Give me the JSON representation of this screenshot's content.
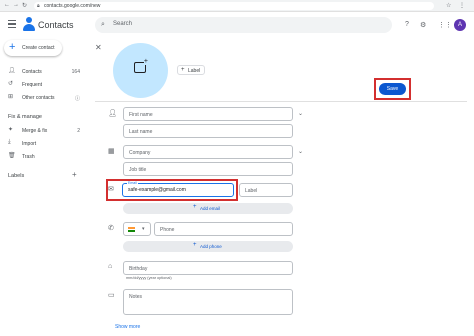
{
  "browser": {
    "url": "contacts.google.com/new",
    "nav_icons": [
      "back-icon",
      "forward-icon",
      "reload-icon"
    ]
  },
  "header": {
    "app_title": "Contacts",
    "search_placeholder": "Search",
    "avatar_letter": "A"
  },
  "sidebar": {
    "create_label": "Create contact",
    "items": [
      {
        "label": "Contacts",
        "count": "164",
        "icon": "person-icon"
      },
      {
        "label": "Frequent",
        "icon": "history-icon"
      },
      {
        "label": "Other contacts",
        "icon": "person-add-icon",
        "info": "ⓘ"
      }
    ],
    "fix_heading": "Fix & manage",
    "fix_items": [
      {
        "label": "Merge & fix",
        "count": "2",
        "icon": "merge-icon"
      },
      {
        "label": "Import",
        "icon": "import-icon"
      },
      {
        "label": "Trash",
        "icon": "trash-icon"
      }
    ],
    "labels_heading": "Labels"
  },
  "editor": {
    "label_button": "Label",
    "save_label": "Save",
    "fields": {
      "first_name": "First name",
      "last_name": "Last name",
      "company": "Company",
      "job_title": "Job title",
      "email_float": "Email",
      "email_value": "safe-example@gmail.com",
      "email_label": "Label",
      "add_email": "Add email",
      "phone": "Phone",
      "add_phone": "Add phone",
      "birthday": "Birthday",
      "birthday_hint": "mm/dd/yyyy (year optional)",
      "notes": "Notes"
    },
    "show_more": "Show more"
  },
  "colors": {
    "accent": "#1a73e8",
    "save_bg": "#0b57d0",
    "highlight": "#d32f2f",
    "photo_bg": "#c2e7ff"
  }
}
